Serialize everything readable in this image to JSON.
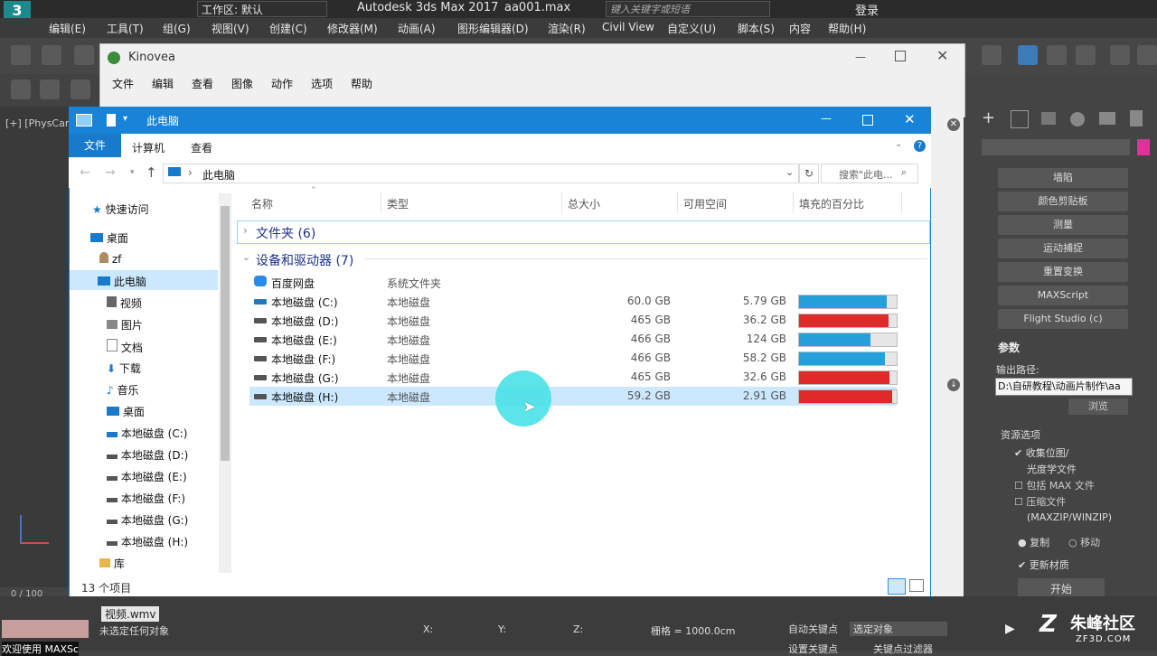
{
  "max": {
    "workspace_label": "工作区: 默认",
    "title": "Autodesk 3ds Max 2017",
    "file": "aa001.max",
    "search_placeholder": "键入关键字或短语",
    "login": "登录",
    "menu": [
      "编辑(E)",
      "工具(T)",
      "组(G)",
      "视图(V)",
      "创建(C)",
      "修改器(M)",
      "动画(A)",
      "图形编辑器(D)",
      "渲染(R)",
      "Civil View",
      "自定义(U)",
      "脚本(S)",
      "内容",
      "帮助(H)"
    ],
    "viewport_label": "[+] [PhysCam",
    "panel_buttons": [
      "墙陷",
      "颜色剪贴板",
      "测量",
      "运动捕捉",
      "重置变换",
      "MAXScript",
      "Flight Studio (c)"
    ],
    "params_title": "参数",
    "output_path_label": "输出路径:",
    "output_path_value": "D:\\自研教程\\动画片制作\\aa",
    "browse": "浏览",
    "resource_title": "资源选项",
    "options": [
      "收集位图/",
      "光度学文件",
      "包括 MAX 文件",
      "压缩文件",
      "(MAXZIP/WINZIP)"
    ],
    "radio_copy": "复制",
    "radio_move": "移动",
    "update_materials": "更新材质",
    "start": "开始",
    "status_left": "未选定任何对象",
    "status_welcome": "欢迎使用 MAXSc",
    "grid_label": "栅格 = 1000.0cm",
    "autokey": "自动关键点",
    "selected_obj": "选定对象",
    "setkey": "设置关键点",
    "keyfilter": "关键点过滤器",
    "x_label": "X:",
    "y_label": "Y:",
    "z_label": "Z:",
    "timeline": "0 / 100",
    "video_file": "视频.wmv",
    "watermark": "朱峰社区",
    "watermark_url": "ZF3D.COM"
  },
  "kinovea": {
    "title": "Kinovea",
    "menu": [
      "文件",
      "编辑",
      "查看",
      "图像",
      "动作",
      "选项",
      "帮助"
    ]
  },
  "explorer": {
    "title": "此电脑",
    "ribbon_tabs": [
      "文件",
      "计算机",
      "查看"
    ],
    "address": "此电脑",
    "search_placeholder": "搜索\"此电...",
    "columns": [
      "名称",
      "类型",
      "总大小",
      "可用空间",
      "填充的百分比"
    ],
    "nav": [
      "快速访问",
      "桌面",
      "zf",
      "此电脑",
      "视频",
      "图片",
      "文档",
      "下载",
      "音乐",
      "桌面",
      "本地磁盘 (C:)",
      "本地磁盘 (D:)",
      "本地磁盘 (E:)",
      "本地磁盘 (F:)",
      "本地磁盘 (G:)",
      "本地磁盘 (H:)",
      "库"
    ],
    "group_folders": "文件夹 (6)",
    "group_devices": "设备和驱动器 (7)",
    "baidu": {
      "name": "百度网盘",
      "type": "系统文件夹"
    },
    "drives": [
      {
        "name": "本地磁盘 (C:)",
        "type": "本地磁盘",
        "total": "60.0 GB",
        "free": "5.79 GB",
        "used_pct": 90,
        "color": "#26a0da"
      },
      {
        "name": "本地磁盘 (D:)",
        "type": "本地磁盘",
        "total": "465 GB",
        "free": "36.2 GB",
        "used_pct": 92,
        "color": "#e02a2a"
      },
      {
        "name": "本地磁盘 (E:)",
        "type": "本地磁盘",
        "total": "466 GB",
        "free": "124 GB",
        "used_pct": 73,
        "color": "#26a0da"
      },
      {
        "name": "本地磁盘 (F:)",
        "type": "本地磁盘",
        "total": "466 GB",
        "free": "58.2 GB",
        "used_pct": 88,
        "color": "#26a0da"
      },
      {
        "name": "本地磁盘 (G:)",
        "type": "本地磁盘",
        "total": "465 GB",
        "free": "32.6 GB",
        "used_pct": 93,
        "color": "#e02a2a"
      },
      {
        "name": "本地磁盘 (H:)",
        "type": "本地磁盘",
        "total": "59.2 GB",
        "free": "2.91 GB",
        "used_pct": 95,
        "color": "#e02a2a"
      }
    ],
    "status": "13 个项目"
  }
}
